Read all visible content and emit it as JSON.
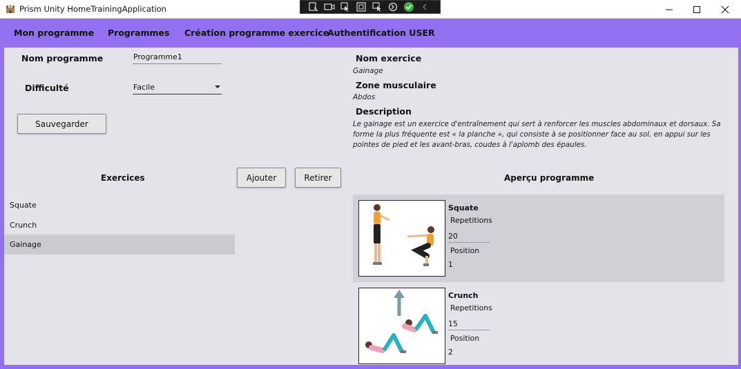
{
  "window": {
    "title": "Prism Unity HomeTrainingApplication"
  },
  "menu": {
    "items": [
      {
        "label": "Mon programme"
      },
      {
        "label": "Programmes"
      },
      {
        "label": "Création programme exercice"
      },
      {
        "label": "Authentification USER"
      }
    ]
  },
  "form": {
    "nom_label": "Nom programme",
    "nom_value": "Programme1",
    "difficulte_label": "Difficulté",
    "difficulte_value": "Facile",
    "save_label": "Sauvegarder"
  },
  "detail": {
    "nom_exercice_label": "Nom exercice",
    "nom_exercice_value": "Gainage",
    "zone_label": "Zone musculaire",
    "zone_value": "Abdos",
    "description_label": "Description",
    "description_value": "Le gainage est un exercice d'entraînement qui sert à renforcer les muscles abdominaux et dorsaux. Sa forme la plus fréquente est « la planche », qui consiste à se positionner face au sol, en appui sur les pointes de pied et les avant-bras, coudes à l'aplomb des épaules."
  },
  "exercises": {
    "header": "Exercices",
    "add_label": "Ajouter",
    "remove_label": "Retirer",
    "items": [
      {
        "label": "Squate"
      },
      {
        "label": "Crunch"
      },
      {
        "label": "Gainage"
      }
    ],
    "selected": "Gainage"
  },
  "preview": {
    "header": "Aperçu programme",
    "cards": [
      {
        "name": "Squate",
        "repetitions_label": "Repetitions",
        "repetitions": "20",
        "position_label": "Position",
        "position": "1"
      },
      {
        "name": "Crunch",
        "repetitions_label": "Repetitions",
        "repetitions": "15",
        "position_label": "Position",
        "position": "2"
      }
    ]
  },
  "colors": {
    "accent": "#9370f0",
    "content_bg": "#e3e3e9",
    "selected_bg": "#cbcbd2"
  },
  "icons": {
    "app": "castle-icon",
    "window_controls": [
      "minimize-icon",
      "maximize-icon",
      "close-icon"
    ]
  }
}
